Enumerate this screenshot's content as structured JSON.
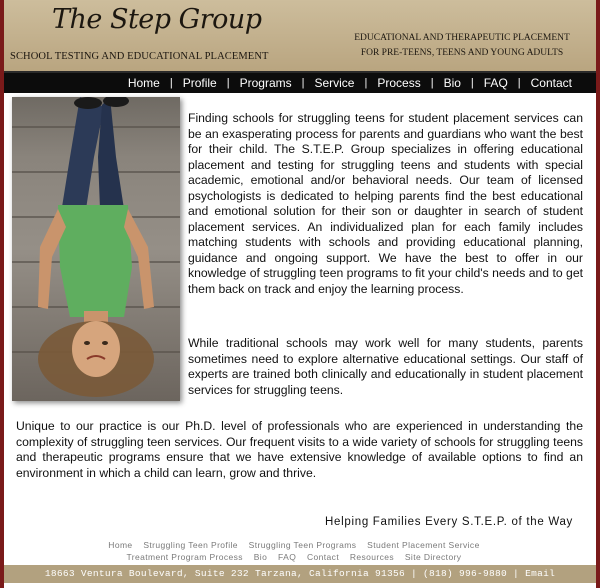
{
  "header": {
    "logo_text": "The Step Group",
    "logo_subtitle": "SCHOOL TESTING AND EDUCATIONAL PLACEMENT",
    "tagline_line1": "EDUCATIONAL AND THERAPEUTIC PLACEMENT",
    "tagline_line2": "FOR PRE-TEENS, TEENS AND YOUNG ADULTS"
  },
  "nav": {
    "items": [
      "Home",
      "Profile",
      "Programs",
      "Service",
      "Process",
      "Bio",
      "FAQ",
      "Contact"
    ],
    "separator": "|"
  },
  "content": {
    "paragraph1": "Finding schools for struggling teens for student placement services can be an exasperating process for parents and guardians who want the best for their child. The S.T.E.P. Group specializes in offering educational placement and testing for struggling teens and students with special academic, emotional and/or behavioral needs. Our team of licensed psychologists is dedicated to helping parents find the best educational and emotional solution for their son or daughter in search of student placement services. An individualized plan for each family includes matching students with schools and providing educational planning, guidance and ongoing support. We have the best to offer in our knowledge of struggling teen programs to fit your child's needs and to get them back on track and enjoy the learning process.",
    "paragraph2": "While traditional schools may work well for many students, parents sometimes need to explore alternative educational settings. Our staff of experts are trained both clinically and educationally in student placement services for struggling teens.",
    "paragraph3": "Unique to our practice is our Ph.D. level of professionals who are experienced in understanding the complexity of struggling teen services. Our frequent visits to a wide variety of schools for struggling teens and therapeutic programs ensure that we have extensive knowledge of available options to find an environment in which a child can learn, grow and thrive.",
    "tagline": "Helping Families Every S.T.E.P. of the Way"
  },
  "footer": {
    "links_row1": [
      "Home",
      "Struggling Teen Profile",
      "Struggling Teen Programs",
      "Student Placement Service"
    ],
    "links_row2": [
      "Treatment Program Process",
      "Bio",
      "FAQ",
      "Contact",
      "Resources",
      "Site Directory"
    ],
    "address": "18663 Ventura Boulevard, Suite 232 Tarzana, California 91356",
    "phone": "(818) 996-9880",
    "email_label": "Email",
    "separator": "|"
  },
  "colors": {
    "frame": "#7a1a1a",
    "header_bg": "#c4b392",
    "nav_bg": "#0c0c0c",
    "footer_bar": "#b2a17f"
  }
}
